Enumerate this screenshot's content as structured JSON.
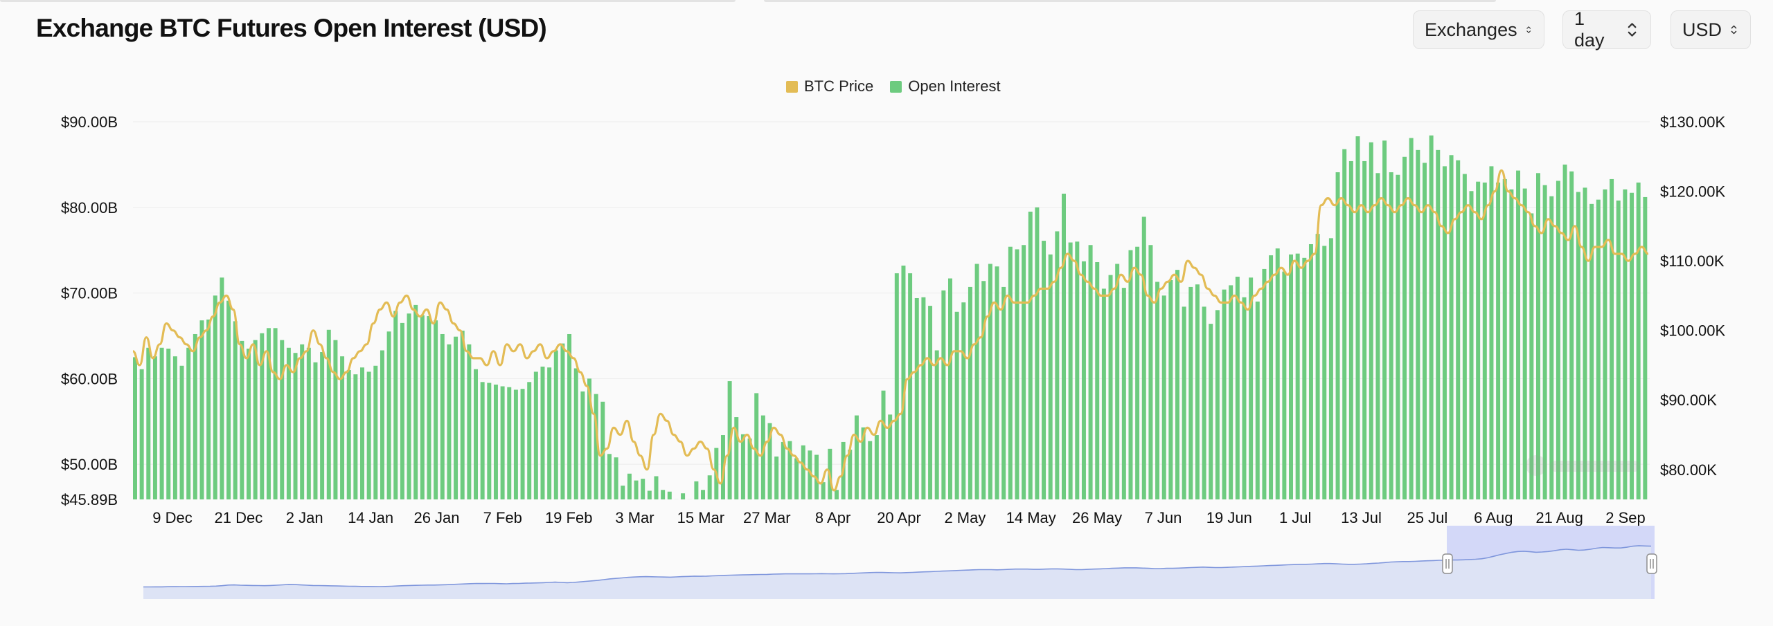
{
  "header": {
    "title": "Exchange BTC Futures Open Interest (USD)",
    "controls": [
      {
        "label": "Exchanges"
      },
      {
        "label": "1 day"
      },
      {
        "label": "USD"
      }
    ]
  },
  "colors": {
    "open_interest": "#6dcb7f",
    "btc_price": "#e3bc55",
    "navigator_line": "#7f96dc",
    "navigator_fill": "#dde3f5",
    "navigator_selection": "#d3d8f8"
  },
  "chart_data": {
    "type": "bar",
    "legend": {
      "position": "top-center",
      "entries": [
        "BTC Price",
        "Open Interest"
      ]
    },
    "y_left": {
      "ticks": [
        "$90.00B",
        "$80.00B",
        "$70.00B",
        "$60.00B",
        "$50.00B"
      ],
      "tick_values": [
        90,
        80,
        70,
        60,
        50
      ],
      "min_label": "$45.89B",
      "range": [
        45.89,
        90
      ]
    },
    "y_right": {
      "ticks": [
        "$130.00K",
        "$120.00K",
        "$110.00K",
        "$100.00K",
        "$90.00K",
        "$80.00K"
      ],
      "tick_values": [
        130,
        120,
        110,
        100,
        90,
        80
      ],
      "range": [
        75.7,
        130
      ]
    },
    "x_ticks": [
      "9 Dec",
      "21 Dec",
      "2 Jan",
      "14 Jan",
      "26 Jan",
      "7 Feb",
      "19 Feb",
      "3 Mar",
      "15 Mar",
      "27 Mar",
      "8 Apr",
      "20 Apr",
      "2 May",
      "14 May",
      "26 May",
      "7 Jun",
      "19 Jun",
      "1 Jul",
      "13 Jul",
      "25 Jul",
      "6 Aug",
      "21 Aug",
      "2 Sep"
    ],
    "grid": true,
    "series": [
      {
        "name": "Open Interest",
        "type": "bar",
        "axis": "left",
        "values": [
          62.5,
          61.1,
          63.6,
          62.6,
          63.6,
          63.5,
          62.6,
          61.5,
          63.6,
          65.2,
          66.8,
          66.9,
          69.7,
          71.8,
          69.1,
          66.7,
          64.4,
          63.5,
          64.5,
          65.3,
          65.9,
          65.9,
          64.5,
          63.6,
          63.0,
          64.0,
          63.6,
          61.9,
          63.1,
          65.7,
          64.5,
          62.6,
          61.0,
          60.5,
          61.3,
          60.8,
          61.5,
          63.3,
          65.5,
          67.9,
          66.5,
          67.6,
          68.6,
          67.4,
          67.3,
          66.8,
          65.2,
          64.0,
          64.9,
          65.6,
          64.0,
          61.1,
          59.6,
          59.5,
          59.3,
          59.1,
          59.0,
          58.7,
          58.8,
          59.6,
          60.8,
          61.4,
          61.3,
          63.3,
          64.1,
          65.2,
          61.2,
          58.5,
          60.0,
          58.2,
          57.3,
          51.2,
          50.8,
          47.5,
          48.9,
          48.1,
          48.3,
          46.9,
          48.6,
          47.0,
          46.8,
          45.9,
          46.6,
          45.9,
          48.0,
          47.0,
          48.7,
          51.9,
          53.4,
          59.7,
          55.5,
          53.5,
          53.0,
          58.3,
          55.7,
          54.8,
          50.9,
          52.6,
          52.7,
          50.7,
          52.2,
          51.6,
          51.1,
          47.9,
          51.8,
          47.0,
          52.6,
          51.7,
          55.7,
          54.3,
          52.7,
          53.4,
          58.6,
          55.8,
          72.3,
          73.2,
          72.3,
          69.4,
          69.5,
          68.5,
          63.3,
          70.3,
          71.7,
          67.8,
          68.9,
          70.7,
          73.4,
          71.4,
          73.4,
          73.1,
          70.7,
          75.4,
          75.1,
          75.6,
          79.5,
          80.0,
          76.1,
          74.5,
          77.2,
          81.6,
          75.9,
          76.0,
          73.7,
          75.6,
          73.6,
          70.5,
          72.1,
          73.4,
          70.6,
          75.0,
          75.4,
          78.9,
          75.6,
          71.3,
          69.7,
          71.5,
          72.7,
          68.4,
          70.7,
          71.0,
          68.4,
          66.4,
          68.0,
          70.4,
          70.9,
          71.9,
          69.5,
          71.8,
          69.0,
          72.8,
          74.4,
          75.2,
          72.5,
          74.5,
          74.6,
          74.1,
          75.7,
          76.9,
          75.5,
          76.4,
          84.1,
          86.8,
          85.4,
          88.3,
          85.4,
          87.6,
          84.0,
          87.8,
          84.1,
          83.8,
          85.9,
          88.1,
          86.7,
          85.2,
          88.4,
          86.7,
          84.8,
          86.1,
          85.5,
          83.9,
          81.9,
          83.0,
          82.9,
          84.8,
          82.9,
          83.3,
          82.1,
          84.3,
          82.2,
          79.3,
          84.0,
          82.6,
          81.3,
          83.1,
          85.0,
          84.2,
          81.8,
          82.3,
          80.4,
          80.9,
          82.1,
          83.3,
          80.8,
          82.1,
          81.7,
          82.9,
          81.2
        ]
      },
      {
        "name": "BTC Price",
        "type": "line",
        "axis": "right",
        "values": [
          97,
          95,
          99,
          96,
          98,
          101,
          100,
          99,
          98,
          97,
          99,
          100,
          102,
          104,
          105,
          103,
          98,
          96,
          98,
          95,
          97,
          94,
          93,
          95,
          94,
          96,
          97,
          100,
          98,
          96,
          94,
          93,
          94,
          96,
          97,
          98,
          101,
          103,
          104,
          102,
          104,
          105,
          103,
          102,
          103,
          101,
          104,
          103,
          101,
          100,
          97,
          96,
          96,
          95,
          97,
          95,
          98,
          97,
          98,
          96,
          97,
          98,
          96,
          97,
          98,
          97,
          96,
          94,
          92,
          88,
          82,
          83,
          86,
          85,
          87,
          84,
          82,
          80,
          85,
          88,
          87,
          85,
          84,
          82,
          83,
          84,
          83,
          80,
          78,
          82,
          86,
          84,
          85,
          83,
          82,
          84,
          86,
          85,
          83,
          82,
          81,
          80,
          79,
          78,
          80,
          77,
          79,
          82,
          85,
          84,
          86,
          85,
          87,
          86,
          87,
          88,
          93,
          94,
          95,
          96,
          95,
          96,
          95,
          97,
          97,
          96,
          98,
          99,
          102,
          104,
          103,
          105,
          104,
          104,
          104,
          105,
          106,
          106,
          107,
          109,
          111,
          110,
          108,
          107,
          106,
          105,
          105,
          106,
          108,
          107,
          109,
          108,
          105,
          104,
          106,
          107,
          108,
          107,
          110,
          109,
          108,
          106,
          105,
          104,
          104,
          105,
          104,
          103,
          105,
          106,
          107,
          108,
          109,
          108,
          110,
          109,
          110,
          111,
          118,
          119,
          118,
          119,
          118,
          117,
          118,
          117,
          118,
          119,
          118,
          117,
          118,
          119,
          118,
          117,
          118,
          117,
          115,
          114,
          116,
          117,
          118,
          117,
          116,
          118,
          120,
          123,
          120,
          119,
          118,
          117,
          115,
          114,
          116,
          115,
          114,
          113,
          115,
          112,
          110,
          112,
          112,
          113,
          111,
          111,
          110,
          111,
          112,
          111
        ]
      }
    ],
    "navigator": {
      "type": "area",
      "values": [
        48,
        48,
        48.5,
        48.3,
        49,
        49.2,
        49.5,
        49.4,
        49.8,
        50,
        50.2,
        50.5,
        51.5,
        53,
        55.5,
        56,
        55,
        54.5,
        54,
        53.5,
        53,
        54,
        55,
        56.5,
        58,
        57.5,
        56,
        55,
        54,
        53.5,
        53,
        52.5,
        52,
        51.5,
        51,
        50.5,
        50,
        50,
        49.8,
        49.5,
        50,
        51,
        52,
        53,
        54,
        54.5,
        55,
        55.5,
        55.5,
        56,
        57,
        58,
        59,
        60,
        61,
        62,
        61.5,
        62,
        62,
        61,
        60.5,
        61.5,
        62,
        63,
        63.5,
        64,
        65,
        66,
        67,
        66,
        65,
        66,
        68,
        70,
        72,
        74,
        77,
        80,
        82,
        84,
        86,
        87.5,
        88.5,
        89,
        88.5,
        88,
        87.5,
        87,
        88,
        89,
        90,
        91,
        90.5,
        91,
        92,
        93,
        94,
        95,
        95.5,
        96,
        96.5,
        97,
        97.5,
        98,
        99,
        99.5,
        100,
        100,
        100,
        100,
        100,
        100.5,
        101,
        100.5,
        100,
        100.5,
        101,
        102,
        103,
        104,
        105,
        106,
        105.5,
        105,
        104.5,
        104,
        105,
        106,
        107,
        108,
        109,
        110,
        111,
        112,
        113,
        114,
        115,
        116,
        117,
        117,
        117,
        116,
        117,
        118,
        119,
        119,
        119,
        118,
        118,
        119,
        120,
        120,
        119,
        118,
        117,
        117,
        118,
        119,
        120,
        121,
        122,
        123,
        124,
        124,
        124,
        123,
        122,
        121,
        121,
        122,
        122,
        123,
        124,
        125,
        126,
        127,
        126,
        125,
        125,
        126,
        127,
        128,
        129,
        130,
        131,
        132,
        133,
        134,
        135,
        136,
        137,
        138,
        138,
        139,
        140,
        141,
        141,
        140,
        139,
        138,
        138,
        139,
        140,
        142,
        143,
        145,
        147,
        148,
        149,
        149,
        150,
        151,
        152,
        153,
        154,
        154,
        155,
        155,
        156,
        157,
        158,
        160,
        164,
        170,
        176,
        181,
        186,
        189,
        190,
        188,
        186,
        187,
        189,
        192,
        196,
        198,
        196,
        194,
        195,
        198,
        202,
        205,
        204,
        203,
        203,
        206,
        210,
        212,
        211,
        210
      ]
    }
  }
}
